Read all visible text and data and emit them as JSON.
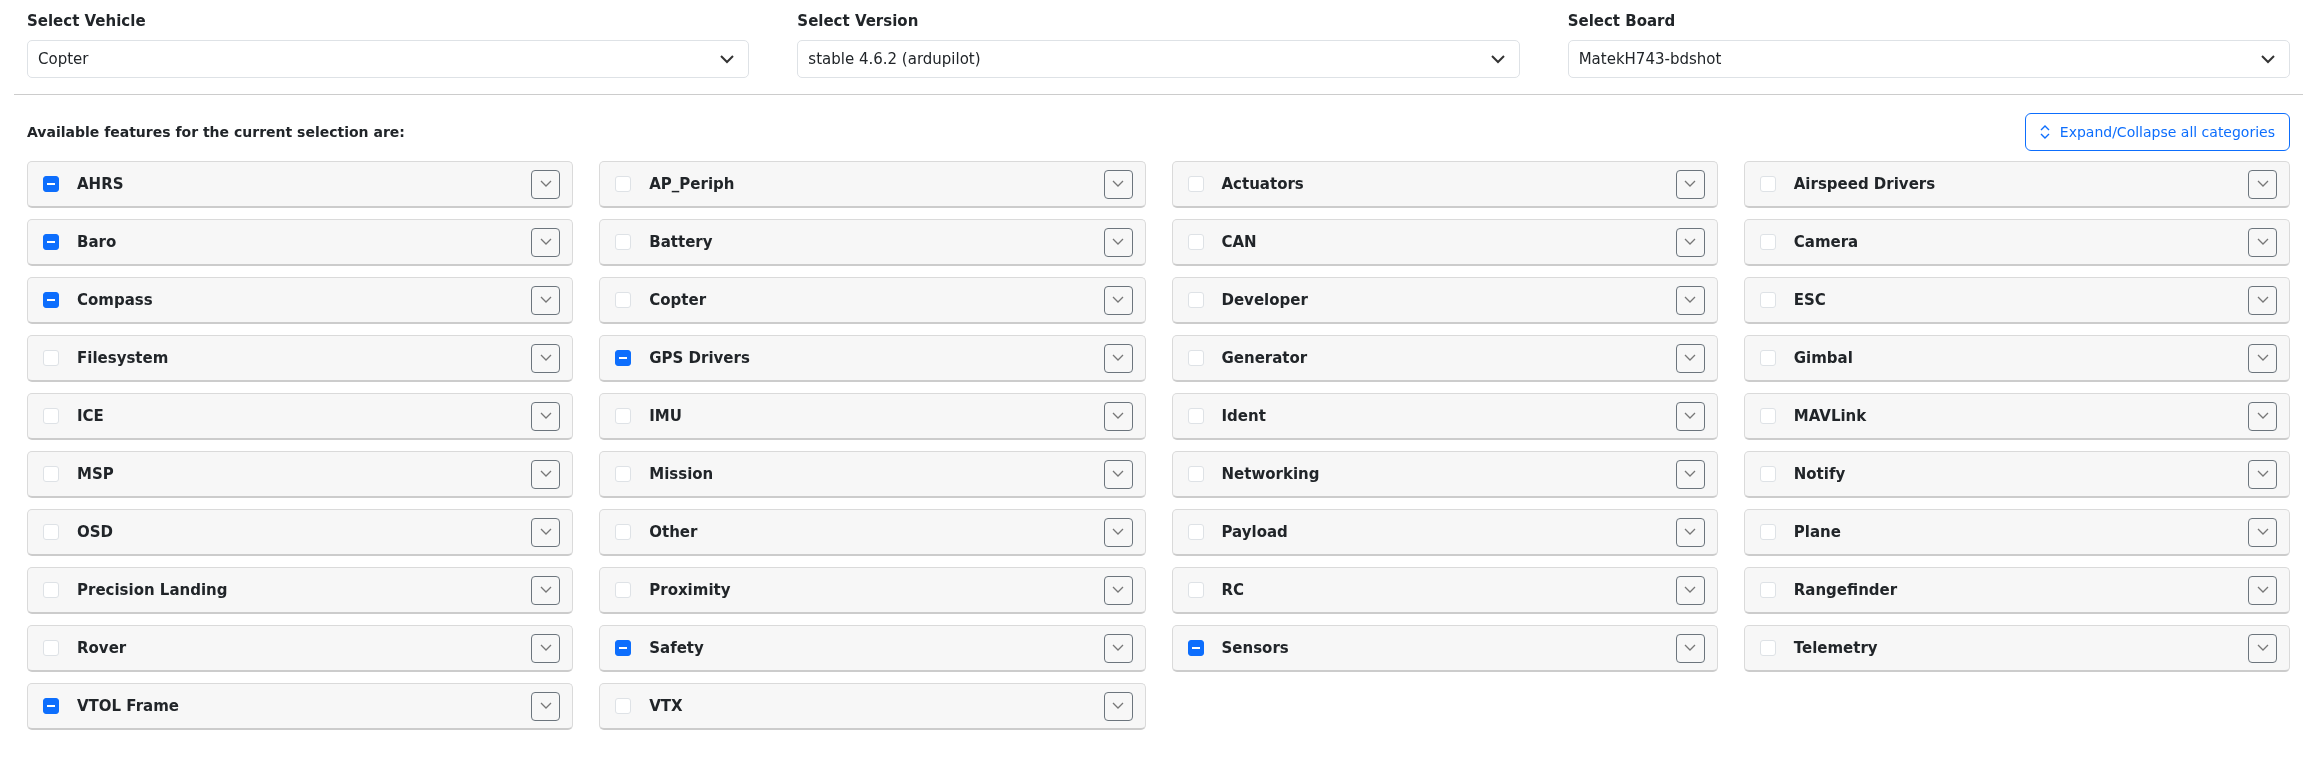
{
  "selects": [
    {
      "label": "Select Vehicle",
      "value": "Copter"
    },
    {
      "label": "Select Version",
      "value": "stable 4.6.2 (ardupilot)"
    },
    {
      "label": "Select Board",
      "value": "MatekH743-bdshot"
    }
  ],
  "features_heading": "Available features for the current selection are:",
  "expand_button": {
    "label": "Expand/Collapse all categories"
  },
  "categories": [
    {
      "name": "AHRS",
      "indeterminate": true
    },
    {
      "name": "AP_Periph",
      "indeterminate": false
    },
    {
      "name": "Actuators",
      "indeterminate": false
    },
    {
      "name": "Airspeed Drivers",
      "indeterminate": false
    },
    {
      "name": "Baro",
      "indeterminate": true
    },
    {
      "name": "Battery",
      "indeterminate": false
    },
    {
      "name": "CAN",
      "indeterminate": false
    },
    {
      "name": "Camera",
      "indeterminate": false
    },
    {
      "name": "Compass",
      "indeterminate": true
    },
    {
      "name": "Copter",
      "indeterminate": false
    },
    {
      "name": "Developer",
      "indeterminate": false
    },
    {
      "name": "ESC",
      "indeterminate": false
    },
    {
      "name": "Filesystem",
      "indeterminate": false
    },
    {
      "name": "GPS Drivers",
      "indeterminate": true
    },
    {
      "name": "Generator",
      "indeterminate": false
    },
    {
      "name": "Gimbal",
      "indeterminate": false
    },
    {
      "name": "ICE",
      "indeterminate": false
    },
    {
      "name": "IMU",
      "indeterminate": false
    },
    {
      "name": "Ident",
      "indeterminate": false
    },
    {
      "name": "MAVLink",
      "indeterminate": false
    },
    {
      "name": "MSP",
      "indeterminate": false
    },
    {
      "name": "Mission",
      "indeterminate": false
    },
    {
      "name": "Networking",
      "indeterminate": false
    },
    {
      "name": "Notify",
      "indeterminate": false
    },
    {
      "name": "OSD",
      "indeterminate": false
    },
    {
      "name": "Other",
      "indeterminate": false
    },
    {
      "name": "Payload",
      "indeterminate": false
    },
    {
      "name": "Plane",
      "indeterminate": false
    },
    {
      "name": "Precision Landing",
      "indeterminate": false
    },
    {
      "name": "Proximity",
      "indeterminate": false
    },
    {
      "name": "RC",
      "indeterminate": false
    },
    {
      "name": "Rangefinder",
      "indeterminate": false
    },
    {
      "name": "Rover",
      "indeterminate": false
    },
    {
      "name": "Safety",
      "indeterminate": true
    },
    {
      "name": "Sensors",
      "indeterminate": true
    },
    {
      "name": "Telemetry",
      "indeterminate": false
    },
    {
      "name": "VTOL Frame",
      "indeterminate": true
    },
    {
      "name": "VTX",
      "indeterminate": false
    }
  ]
}
